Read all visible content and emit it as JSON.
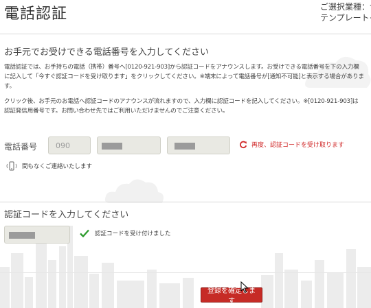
{
  "header": {
    "title": "電話認証",
    "industry_label": "ご選択業種：",
    "industry_value": "食",
    "template_label": "テンプレートイ"
  },
  "phone_section": {
    "title": "お手元でお受けできる電話番号を入力してください",
    "paragraph1_line1": "電話認証では、お手持ちの電話（携帯）番号へ[0120-921-903]から認証コードをアナウンスします。お受けできる電話番号を下の入力欄",
    "paragraph1_line2": "に記入して「今すぐ認証コードを受け取ります」をクリックしてください。※端末によって電話番号が[通知不可能]と表示する場合があります。",
    "paragraph2_line1": "クリック後、お手元のお電話へ認証コードのアナウンスが流れますので、入力欄に認証コードを記入してください。※[0120-921-903]は",
    "paragraph2_line2": "認証発信用番号です。お問い合わせ先ではご利用いただけませんのでご注意ください。",
    "phone_label": "電話番号",
    "phone_part1_value": "090",
    "retry_link": "再度、認証コードを受け取ります",
    "contact_note": "間もなくご連絡いたします"
  },
  "code_section": {
    "title": "認証コードを入力してください",
    "accepted_message": "認証コードを受け付けました"
  },
  "submit_label": "登録を確定します",
  "colors": {
    "accent": "#c62b26",
    "check": "#2e9b2e",
    "field_bg": "#e9e9e3"
  }
}
